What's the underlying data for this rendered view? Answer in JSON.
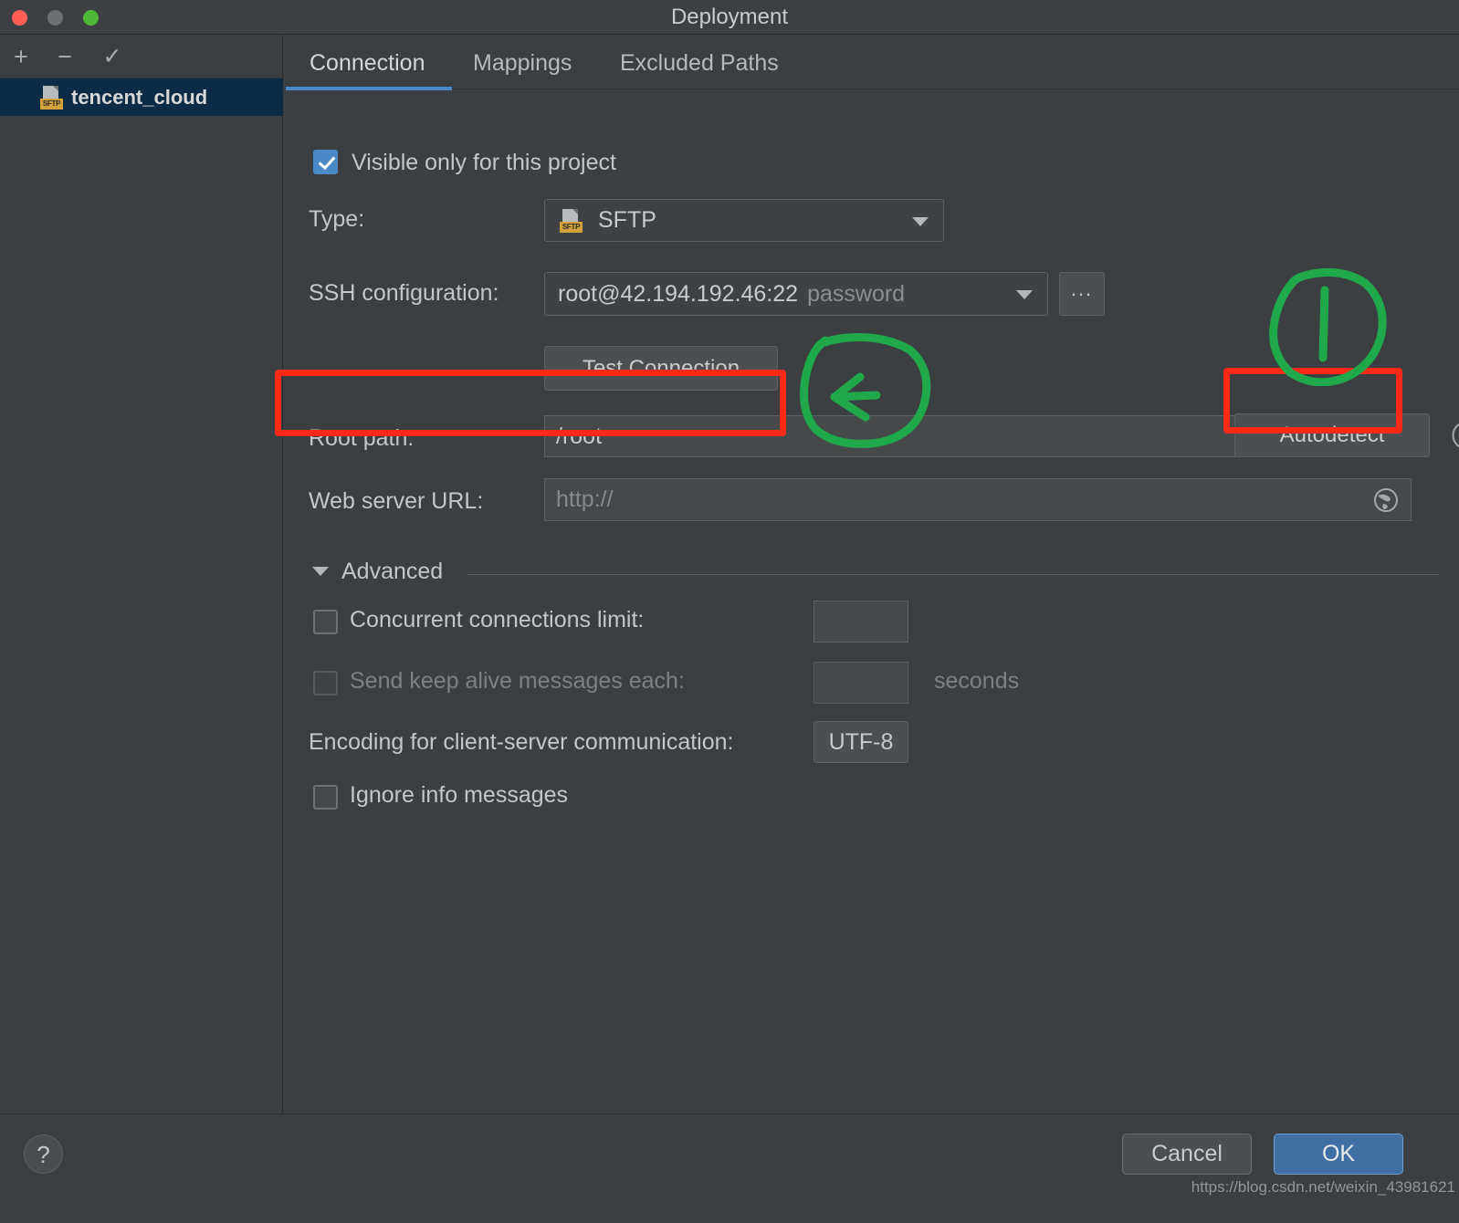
{
  "window": {
    "title": "Deployment",
    "traffic_lights": [
      "close",
      "minimize",
      "zoom"
    ]
  },
  "sidebar": {
    "toolbar": [
      {
        "name": "add",
        "glyph": "+"
      },
      {
        "name": "remove",
        "glyph": "−"
      },
      {
        "name": "apply-check",
        "glyph": "✓"
      }
    ],
    "items": [
      {
        "label": "tencent_cloud",
        "badge": "SFTP",
        "selected": true
      }
    ]
  },
  "tabs": [
    {
      "label": "Connection",
      "active": true
    },
    {
      "label": "Mappings",
      "active": false
    },
    {
      "label": "Excluded Paths",
      "active": false
    }
  ],
  "form": {
    "visible_only": {
      "label": "Visible only for this project",
      "checked": true
    },
    "type": {
      "label": "Type:",
      "value": "SFTP",
      "badge": "SFTP"
    },
    "ssh_configuration": {
      "label": "SSH configuration:",
      "value": "root@42.194.192.46:22",
      "ghost": "password",
      "browse_label": "..."
    },
    "test_connection": {
      "label": "Test Connection"
    },
    "root_path": {
      "label": "Root path:",
      "value": "/root",
      "folder_icon": "folder-icon",
      "help_icon": "help-icon",
      "autodetect_label": "Autodetect"
    },
    "web_server_url": {
      "label": "Web server URL:",
      "value": "http://",
      "globe_icon": "globe-icon"
    },
    "advanced": {
      "label": "Advanced",
      "expanded": true,
      "concurrent_connections": {
        "label": "Concurrent connections limit:",
        "checked": false,
        "value": ""
      },
      "keep_alive": {
        "label": "Send keep alive messages each:",
        "checked": false,
        "value": "",
        "unit": "seconds",
        "disabled": true
      },
      "encoding": {
        "label": "Encoding for client-server communication:",
        "value": "UTF-8"
      },
      "ignore_info": {
        "label": "Ignore info messages",
        "checked": false
      }
    }
  },
  "footer": {
    "help_glyph": "?",
    "cancel_label": "Cancel",
    "ok_label": "OK",
    "watermark": "https://blog.csdn.net/weixin_43981621"
  },
  "annotations": {
    "red_color": "#fb2a18",
    "green_color": "#1fa94a",
    "boxes": [
      {
        "name": "root-path-highlight"
      },
      {
        "name": "autodetect-highlight"
      }
    ],
    "marks": [
      {
        "name": "green-circle-arrow-rootpath"
      },
      {
        "name": "green-circle-stroke-autodetect"
      }
    ]
  }
}
